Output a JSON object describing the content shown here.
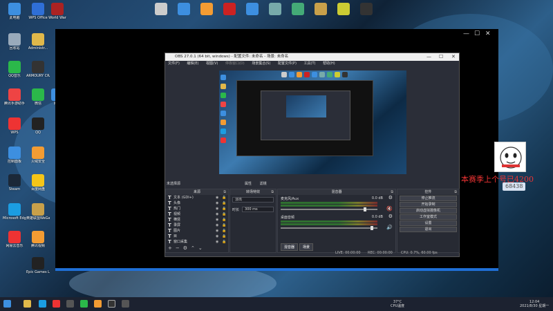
{
  "desktop_icons": [
    {
      "label": "此电脑",
      "color": "#3d8fe0",
      "icon": "computer-icon"
    },
    {
      "label": "WPS Office",
      "color": "#2f6fd6",
      "icon": "wps-icon"
    },
    {
      "label": "World War",
      "color": "#a22",
      "icon": "game-icon"
    },
    {
      "label": "回收站",
      "color": "#9ab",
      "icon": "recycle-bin-icon"
    },
    {
      "label": "Administr...",
      "color": "#e0b84a",
      "icon": "folder-icon"
    },
    {
      "label": "QQ音乐",
      "color": "#2bb84a",
      "icon": "qq-music-icon"
    },
    {
      "label": "ARMOURY CRATE",
      "color": "#333",
      "icon": "armoury-crate-icon"
    },
    {
      "label": "腾讯手游助手",
      "color": "#e44",
      "icon": "game-helper-icon"
    },
    {
      "label": "微信",
      "color": "#2bb84a",
      "icon": "wechat-icon"
    },
    {
      "label": "网络",
      "color": "#3d8fe0",
      "icon": "network-icon"
    },
    {
      "label": "WPS",
      "color": "#e33",
      "icon": "wps-icon"
    },
    {
      "label": "QQ",
      "color": "#222",
      "icon": "qq-icon"
    },
    {
      "label": "控制面板",
      "color": "#3d8fe0",
      "icon": "control-panel-icon"
    },
    {
      "label": "火绒安全",
      "color": "#f39c33",
      "icon": "huorong-icon"
    },
    {
      "label": "Steam",
      "color": "#1b2838",
      "icon": "steam-icon"
    },
    {
      "label": "百度网盘",
      "color": "#f5c518",
      "icon": "baidu-netdisk-icon"
    },
    {
      "label": "Microsoft Edge",
      "color": "#1b9de2",
      "icon": "edge-icon"
    },
    {
      "label": "英雄联盟WeGame",
      "color": "#c8a04a",
      "icon": "lol-icon"
    },
    {
      "label": "网易云音乐",
      "color": "#e33",
      "icon": "netease-music-icon"
    },
    {
      "label": "腾讯视频",
      "color": "#f39c33",
      "icon": "tencent-video-icon"
    },
    {
      "label": "Epic Games Launcher",
      "color": "#222",
      "icon": "epic-games-icon"
    }
  ],
  "top_icons": [
    {
      "color": "#ccc",
      "icon": "file-icon"
    },
    {
      "color": "#3d8fe0",
      "icon": "folder-icon"
    },
    {
      "color": "#f39c33",
      "icon": "app-icon"
    },
    {
      "color": "#c22",
      "icon": "adobe-icon"
    },
    {
      "color": "#3d8fe0",
      "icon": "app-icon"
    },
    {
      "color": "#7aa",
      "icon": "app-icon"
    },
    {
      "color": "#4a7",
      "icon": "app-icon"
    },
    {
      "color": "#c8a04a",
      "icon": "app-icon"
    },
    {
      "color": "#cc3",
      "icon": "geforce-icon"
    },
    {
      "color": "#333",
      "icon": "obs-icon"
    }
  ],
  "obs": {
    "title": "OBS 27.0.1 (64 bit, windows) - 配置文件: 未命名 - 场景: 未命名",
    "menu": [
      "文件(F)",
      "编辑(E)",
      "视图(V)",
      "停靠窗口(D)",
      "场景集合(S)",
      "配置文件(P)",
      "工具(T)",
      "帮助(H)"
    ],
    "scene_label": "未选择源",
    "toggle1": "属性",
    "toggle2": "滤镜",
    "sources": {
      "title": "来源",
      "items": [
        "文本 (GDI+)",
        "头像",
        "热门",
        "视频",
        "横竖",
        "录屏",
        "图片",
        "目",
        "窗口采集"
      ]
    },
    "transitions": {
      "title": "转场特效",
      "type": "淡出",
      "duration_label": "时长",
      "duration": "300 ms"
    },
    "mixer": {
      "title": "混音器",
      "ch1_name": "麦克风/Aux",
      "ch1_db": "0.0 dB",
      "ch2_name": "桌面音频",
      "ch2_db": "0.0 dB",
      "tab1": "混音器",
      "tab2": "场景"
    },
    "controls": {
      "title": "控件",
      "buttons": [
        "停止推流",
        "开始录制",
        "启动虚拟摄像机",
        "工作室模式",
        "设置",
        "退出"
      ]
    },
    "status": {
      "live": "LIVE: 00:00:00",
      "rec": "REC: 00:00:00",
      "cpu": "CPU: 0.7%, 60.00 fps"
    }
  },
  "overlay": {
    "scroll_text": "本赛季上个号已4200",
    "badge_text": "68438"
  },
  "taskbar": {
    "weather": "37°C",
    "weather_sub": "CPU温度",
    "time": "12:04",
    "date": "2021/8/30 星期一"
  }
}
